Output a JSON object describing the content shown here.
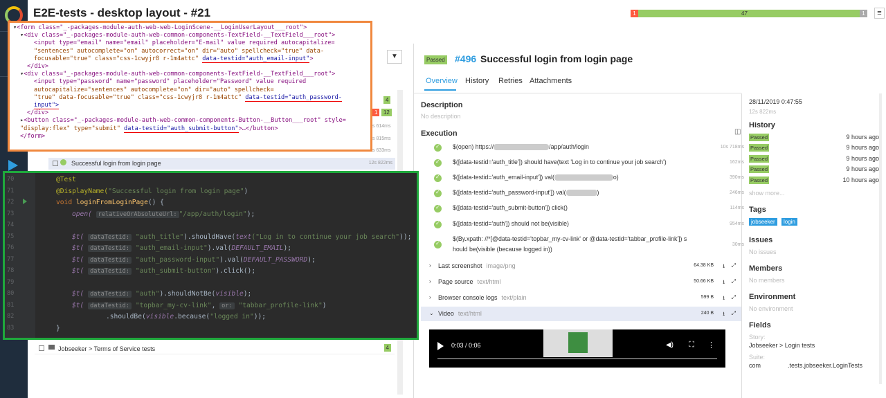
{
  "app": {
    "title": "E2E-tests - desktop layout - #21"
  },
  "statusbar": {
    "failed": "1",
    "passed": "47",
    "skipped": "1"
  },
  "html_snippet": {
    "lines": [
      "<form class=\"_-packages-module-auth-web-web-LoginScene-__LoginUserLayout___root\">",
      "<div class=\"_-packages-module-auth-web-common-components-TextField-__TextField___root\">",
      "<input type=\"email\" name=\"email\" placeholder=\"E-mail\" value required autocapitalize=",
      "\"sentences\" autocomplete=\"on\" autocorrect=\"on\" dir=\"auto\" spellcheck=\"true\" data-",
      "focusable=\"true\" class=\"css-1cwyjr8 r-1m4attc\" ",
      "</div>",
      "<div class=\"_-packages-module-auth-web-common-components-TextField-__TextField___root\">",
      "<input type=\"password\" name=\"password\" placeholder=\"Password\" value required",
      "autocapitalize=\"sentences\" autocomplete=\"on\" dir=\"auto\" spellcheck=",
      "\"true\" data-focusable=\"true\" class=\"css-1cwyjr8 r-1m4attc\" ",
      "input\">",
      "</div>",
      "<button class=\"_-packages-module-auth-web-common-components-Button-__Button___root\" style=",
      "\"display:flex\" type=\"submit\" ",
      "</form>"
    ],
    "testid_email": "data-testid=\"auth_email-input\"",
    "testid_password": "data-testid=\"auth_password-",
    "testid_submit": "data-testid=\"auth_submit-button\"",
    "button_tail": ">…</button>"
  },
  "tree": {
    "selected_item": "Successful login from login page",
    "selected_duration": "12s 822ms",
    "bottom_item": "Jobseeker > Terms of Service tests",
    "bottom_count": "4",
    "side_counts": [
      "4",
      "1",
      "12"
    ],
    "side_durations": [
      "s 614ms",
      "s 815ms",
      "s 633ms"
    ]
  },
  "code": {
    "line_numbers": [
      "70",
      "71",
      "72",
      "73",
      "74",
      "75",
      "76",
      "77",
      "78",
      "79",
      "80",
      "81",
      "82",
      "83"
    ],
    "lines": {
      "l70": "@Test",
      "l71_ann": "@DisplayName(",
      "l71_str": "\"Successful login from login page\"",
      "l71_end": ")",
      "l72_kw": "void ",
      "l72_fn": "loginFromLoginPage",
      "l72_end": "() {",
      "l73_a": "open(",
      "l73_hint": "relativeOrAbsoluteUrl:",
      "l73_str": "\"/app/auth/login\"",
      "l73_end": ");",
      "hint_testid": "dataTestid:",
      "l75_str": "\"auth_title\"",
      "l75_mid": ").shouldHave(",
      "l75_it": "text",
      "l75_str2": "(\"Log in to continue your job search\"",
      "l75_end": "));",
      "l76_str": "\"auth_email-input\"",
      "l76_mid": ").val(",
      "l76_it": "DEFAULT_EMAIL",
      "l76_end": ");",
      "l77_str": "\"auth_password-input\"",
      "l77_it": "DEFAULT_PASSWORD",
      "l78_str": "\"auth_submit-button\"",
      "l78_end": ").click();",
      "l80_str": "\"auth\"",
      "l80_mid": ").shouldNotBe(",
      "l80_it": "visible",
      "l80_end": ");",
      "l81_str": "\"topbar_my-cv-link\"",
      "l81_hint": "or:",
      "l81_str2": "\"tabbar_profile-link\"",
      "l81_end": ")",
      "l82_a": ".shouldBe(",
      "l82_it": "visible",
      "l82_b": ".because(",
      "l82_str": "\"logged in\"",
      "l82_end": "));",
      "l83": "}",
      "dollar": "$t(",
      "comma": ", "
    }
  },
  "result": {
    "status": "Passed",
    "number": "#496",
    "name": "Successful login from login page",
    "tabs": [
      "Overview",
      "History",
      "Retries",
      "Attachments"
    ],
    "description_label": "Description",
    "description_value": "No description",
    "execution_label": "Execution",
    "steps": [
      {
        "text_a": "$(open) https://",
        "text_b": "/app/auth/login",
        "dur": "10s 718ms"
      },
      {
        "text_a": "$([data-testid='auth_title']) should have(text 'Log in to continue your job search')",
        "text_b": "",
        "dur": "162ms"
      },
      {
        "text_a": "$([data-testid='auth_email-input']) val(",
        "text_b": "o)",
        "dur": "390ms"
      },
      {
        "text_a": "$([data-testid='auth_password-input']) val(",
        "text_b": ")",
        "dur": "246ms"
      },
      {
        "text_a": "$([data-testid='auth_submit-button']) click()",
        "text_b": "",
        "dur": "114ms"
      },
      {
        "text_a": "$([data-testid='auth']) should not be(visible)",
        "text_b": "",
        "dur": "954ms"
      },
      {
        "text_a": "$(By.xpath: //*[@data-testid='topbar_my-cv-link' or @data-testid='tabbar_profile-link']) s",
        "text_b": "hould be(visible (because logged in))",
        "dur": "30ms"
      }
    ],
    "attachments": [
      {
        "name": "Last screenshot",
        "mime": "image/png",
        "size": "64.38 KB"
      },
      {
        "name": "Page source",
        "mime": "text/html",
        "size": "50.66 KB"
      },
      {
        "name": "Browser console logs",
        "mime": "text/plain",
        "size": "599 B"
      },
      {
        "name": "Video",
        "mime": "text/html",
        "size": "240 B"
      }
    ],
    "video_time": "0:03 / 0:06"
  },
  "sidebar": {
    "date": "28/11/2019 0:47:55",
    "duration": "12s 822ms",
    "history_label": "History",
    "history": [
      {
        "status": "Passed",
        "ago": "9 hours ago"
      },
      {
        "status": "Passed",
        "ago": "9 hours ago"
      },
      {
        "status": "Passed",
        "ago": "9 hours ago"
      },
      {
        "status": "Passed",
        "ago": "9 hours ago"
      },
      {
        "status": "Passed",
        "ago": "10 hours ago"
      }
    ],
    "show_more": "show more...",
    "tags_label": "Tags",
    "tags": [
      "jobseeker",
      "login"
    ],
    "issues_label": "Issues",
    "issues_value": "No issues",
    "members_label": "Members",
    "members_value": "No members",
    "environment_label": "Environment",
    "environment_value": "No environment",
    "fields_label": "Fields",
    "story_label": "Story:",
    "story_value": "Jobseeker > Login tests",
    "suite_label": "Suite:",
    "suite_value_a": "com",
    "suite_value_b": ".tests.jobseeker.LoginTests"
  },
  "colors": {
    "passed": "#97cc64",
    "failed": "#fd5a3e",
    "accent": "#2f9de0",
    "orange_frame": "#f0883e",
    "green_frame": "#1fa83c"
  },
  "icons": [
    "logo-icon",
    "play-icon",
    "filter-icon",
    "menu-icon",
    "check-icon",
    "download-icon",
    "expand-icon",
    "chevron-right-icon",
    "chevron-down-icon",
    "columns-icon",
    "folder-icon"
  ]
}
